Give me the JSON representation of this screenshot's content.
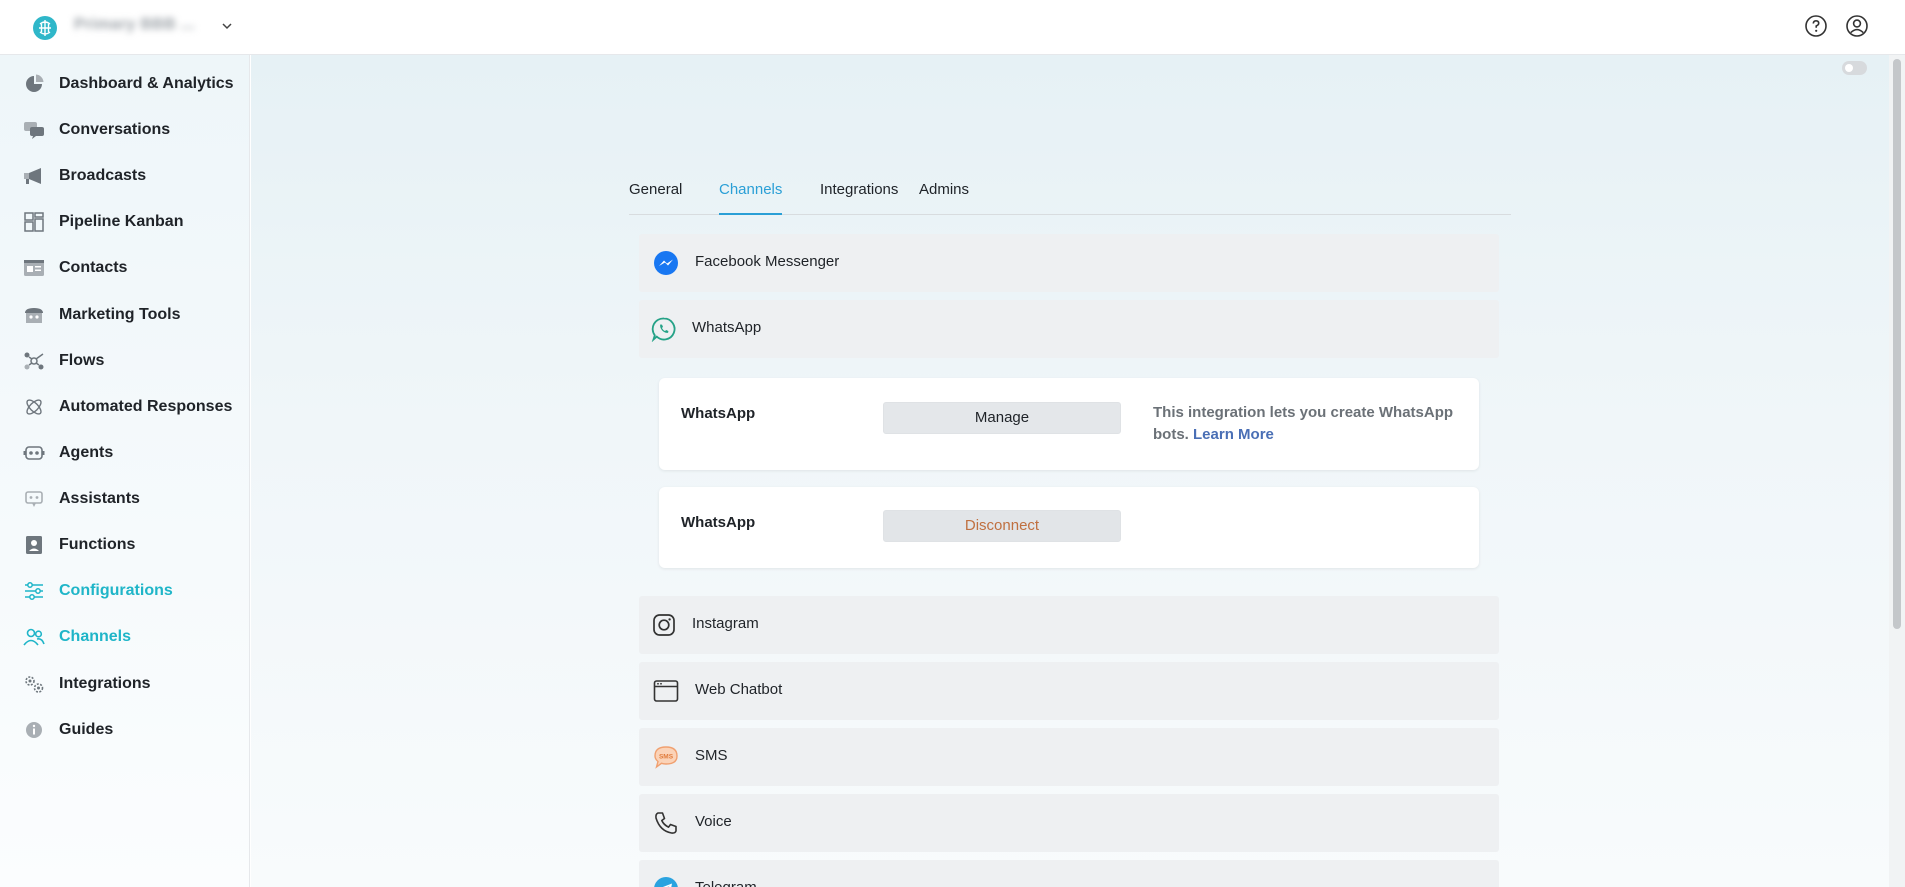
{
  "header": {
    "workspace_name": "Primary BBB ...",
    "icons": [
      "brain-logo-icon",
      "chevron-down-icon",
      "help-icon",
      "user-icon"
    ]
  },
  "sidebar": {
    "items": [
      {
        "label": "Dashboard & Analytics",
        "icon": "pie-chart-icon"
      },
      {
        "label": "Conversations",
        "icon": "chat-bubbles-icon"
      },
      {
        "label": "Broadcasts",
        "icon": "megaphone-icon"
      },
      {
        "label": "Pipeline Kanban",
        "icon": "kanban-icon"
      },
      {
        "label": "Contacts",
        "icon": "contact-card-icon"
      },
      {
        "label": "Marketing Tools",
        "icon": "storefront-icon"
      },
      {
        "label": "Flows",
        "icon": "flow-icon"
      },
      {
        "label": "Automated Responses",
        "icon": "atom-icon"
      },
      {
        "label": "Agents",
        "icon": "robot-icon"
      },
      {
        "label": "Assistants",
        "icon": "assistant-bot-icon"
      },
      {
        "label": "Functions",
        "icon": "function-icon"
      },
      {
        "label": "Configurations",
        "icon": "sliders-icon",
        "active": true
      },
      {
        "label": "Channels",
        "icon": "people-icon",
        "active": true
      },
      {
        "label": "Integrations",
        "icon": "gears-icon"
      },
      {
        "label": "Guides",
        "icon": "info-icon"
      }
    ]
  },
  "tabs": [
    {
      "label": "General"
    },
    {
      "label": "Channels",
      "active": true
    },
    {
      "label": "Integrations"
    },
    {
      "label": "Admins"
    }
  ],
  "channels": {
    "facebook": "Facebook Messenger",
    "whatsapp": "WhatsApp",
    "instagram": "Instagram",
    "web_chatbot": "Web Chatbot",
    "sms": "SMS",
    "voice": "Voice",
    "telegram": "Telegram"
  },
  "whatsapp_cards": [
    {
      "title": "WhatsApp",
      "button": "Manage",
      "description": "This integration lets you create WhatsApp bots.",
      "link": "Learn More"
    },
    {
      "title": "WhatsApp",
      "button": "Disconnect"
    }
  ],
  "colors": {
    "accent": "#1fb5c8",
    "tab_active": "#2a9fd6",
    "link": "#4a6fb5",
    "disconnect": "#c07040"
  }
}
